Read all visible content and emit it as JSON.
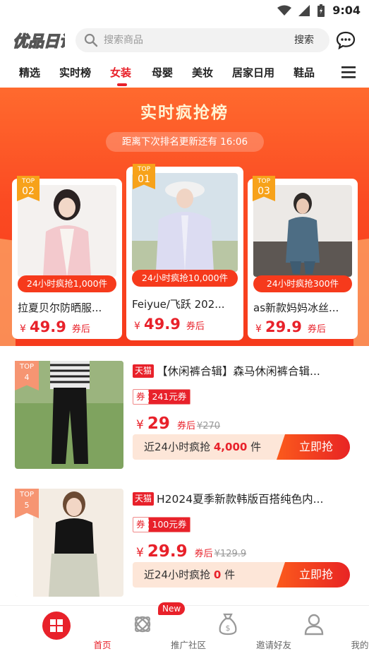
{
  "status_bar": {
    "time": "9:04"
  },
  "header": {
    "logo_text": "优品日记",
    "search_placeholder": "搜索商品",
    "search_button": "搜索"
  },
  "tabs": [
    {
      "label": "精选"
    },
    {
      "label": "实时榜"
    },
    {
      "label": "女装"
    },
    {
      "label": "母婴"
    },
    {
      "label": "美妆"
    },
    {
      "label": "居家日用"
    },
    {
      "label": "鞋品"
    }
  ],
  "hero": {
    "title": "实时疯抢榜",
    "countdown": "距离下次排名更新还有 16:06",
    "cards": [
      {
        "rank_top": "TOP",
        "rank_num": "02",
        "sale": "24小时疯抢1,000件",
        "name": "拉夏贝尔防晒服...",
        "currency": "¥",
        "price": "49.9",
        "coupon_label": "券后"
      },
      {
        "rank_top": "TOP",
        "rank_num": "01",
        "sale": "24小时疯抢10,000件",
        "name": "Feiyue/飞跃 202...",
        "currency": "¥",
        "price": "49.9",
        "coupon_label": "券后"
      },
      {
        "rank_top": "TOP",
        "rank_num": "03",
        "sale": "24小时疯抢300件",
        "name": "as新款妈妈冰丝...",
        "currency": "¥",
        "price": "29.9",
        "coupon_label": "券后"
      }
    ]
  },
  "list": [
    {
      "rank_top": "TOP",
      "rank_num": "4",
      "tag": "天猫",
      "title": "【休闲裤合辑】森马休闲裤合辑...",
      "coupon_label": "券",
      "coupon_value": "241元券",
      "currency": "¥",
      "price": "29",
      "after_label": "券后",
      "orig_price": "¥270",
      "sale_prefix": "近24小时疯抢",
      "sale_num": "4,000",
      "sale_unit": "件",
      "buy": "立即抢"
    },
    {
      "rank_top": "TOP",
      "rank_num": "5",
      "tag": "天猫",
      "title": "H2024夏季新款韩版百搭纯色内...",
      "coupon_label": "券",
      "coupon_value": "100元券",
      "currency": "¥",
      "price": "29.9",
      "after_label": "券后",
      "orig_price": "¥129.9",
      "sale_prefix": "近24小时疯抢",
      "sale_num": "0",
      "sale_unit": "件",
      "buy": "立即抢"
    }
  ],
  "bottom_nav": [
    {
      "label": "首页",
      "icon": "home-grid-icon"
    },
    {
      "label": "推广社区",
      "icon": "community-icon",
      "badge": "New"
    },
    {
      "label": "邀请好友",
      "icon": "money-bag-icon"
    },
    {
      "label": "我的",
      "icon": "profile-icon"
    }
  ],
  "colors": {
    "accent": "#e8212a",
    "banner": "#fb4a22",
    "badge": "#f7a21a"
  }
}
